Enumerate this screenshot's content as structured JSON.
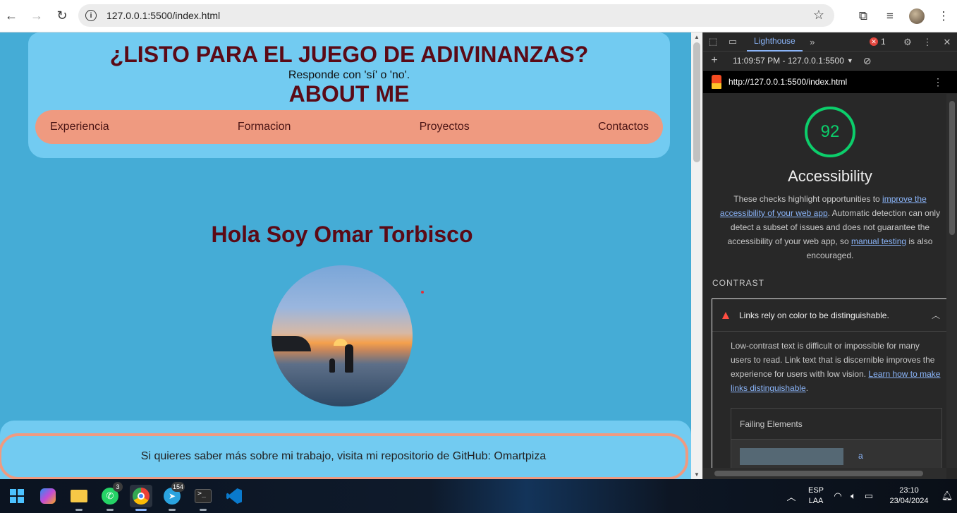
{
  "browser": {
    "url": "127.0.0.1:5500/index.html"
  },
  "page": {
    "title": "¿LISTO PARA EL JUEGO DE ADIVINANZAS?",
    "subtitle": "Responde con 'sí' o 'no'.",
    "about": "ABOUT ME",
    "nav": [
      "Experiencia",
      "Formacion",
      "Proyectos",
      "Contactos"
    ],
    "hero_title": "Hola Soy Omar Torbisco",
    "footer_text": "Si quieres saber más sobre mi trabajo, visita mi repositorio de GitHub: Omartpiza"
  },
  "devtools": {
    "active_tab": "Lighthouse",
    "error_count": "1",
    "report_time": "11:09:57 PM - 127.0.0.1:5500",
    "report_url": "http://127.0.0.1:5500/index.html",
    "score": "92",
    "category": "Accessibility",
    "desc_1": "These checks highlight opportunities to ",
    "desc_link1": "improve the accessibility of your web app",
    "desc_2": ". Automatic detection can only detect a subset of issues and does not guarantee the accessibility of your web app, so ",
    "desc_link2": "manual testing",
    "desc_3": " is also encouraged.",
    "section": "CONTRAST",
    "audit_title": "Links rely on color to be distinguishable.",
    "audit_desc": "Low-contrast text is difficult or impossible for many users to read. Link text that is discernible improves the experience for users with low vision. ",
    "audit_link": "Learn how to make links distinguishable",
    "failing_header": "Failing Elements",
    "failing_node": "a",
    "score_color": "#0cce6b"
  },
  "taskbar": {
    "whatsapp_badge": "3",
    "telegram_badge": "154",
    "lang1": "ESP",
    "lang2": "LAA",
    "time": "23:10",
    "date": "23/04/2024"
  }
}
